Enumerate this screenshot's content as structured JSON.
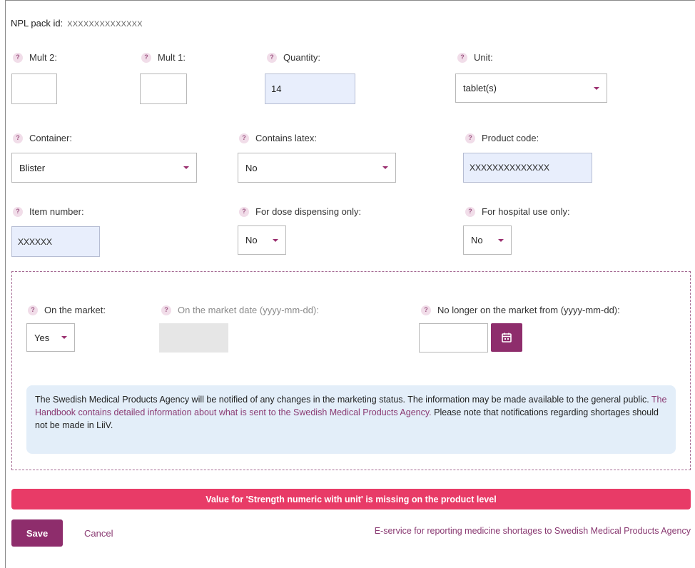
{
  "npl": {
    "label": "NPL pack id:",
    "value": "XXXXXXXXXXXXXX"
  },
  "fields": {
    "mult2": {
      "label": "Mult 2:",
      "value": ""
    },
    "mult1": {
      "label": "Mult 1:",
      "value": ""
    },
    "quantity": {
      "label": "Quantity:",
      "value": "14"
    },
    "unit": {
      "label": "Unit:",
      "value": "tablet(s)"
    },
    "container": {
      "label": "Container:",
      "value": "Blister"
    },
    "contains_latex": {
      "label": "Contains latex:",
      "value": "No"
    },
    "product_code": {
      "label": "Product code:",
      "value": "XXXXXXXXXXXXXX"
    },
    "item_number": {
      "label": "Item number:",
      "value": "XXXXXX"
    },
    "dose_dispensing": {
      "label": "For dose dispensing only:",
      "value": "No"
    },
    "hospital_use": {
      "label": "For hospital use only:",
      "value": "No"
    }
  },
  "market": {
    "on_market": {
      "label": "On the market:",
      "value": "Yes"
    },
    "on_market_date": {
      "label": "On the market date (yyyy-mm-dd):",
      "value": ""
    },
    "no_longer": {
      "label": "No longer on the market from (yyyy-mm-dd):",
      "value": ""
    }
  },
  "info": {
    "text1": "The Swedish Medical Products Agency will be notified of any changes in the marketing status. The information may be made available to the general public.",
    "link": "The Handbook contains detailed information about what is sent to the Swedish Medical Products Agency.",
    "text2": "Please note that notifications regarding shortages should not be made in LiiV."
  },
  "error": "Value for 'Strength numeric with unit' is missing on the product level",
  "actions": {
    "save": "Save",
    "cancel": "Cancel",
    "eservice": "E-service for reporting medicine shortages to Swedish Medical Products Agency"
  },
  "help_glyph": "?",
  "icons": {
    "help": "help-icon",
    "caret": "chevron-down-icon",
    "calendar": "calendar-icon"
  },
  "colors": {
    "accent": "#8e2d6c",
    "error": "#e83b67",
    "info_bg": "#e3eef9",
    "filled_bg": "#e8eefc"
  }
}
